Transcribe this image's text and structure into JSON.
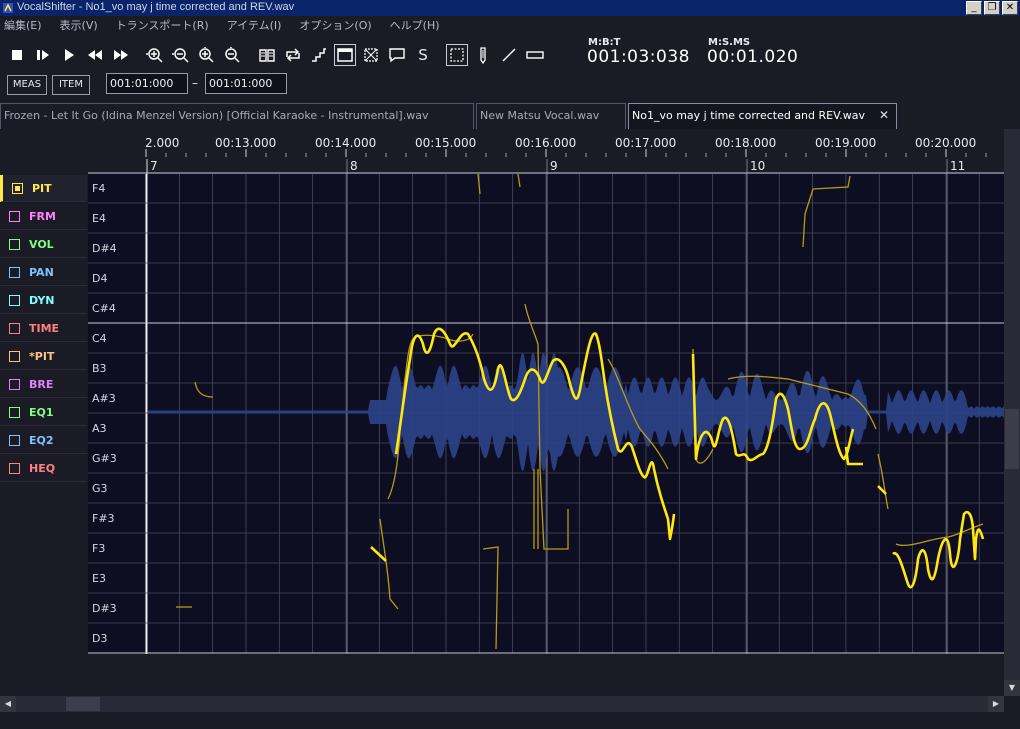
{
  "window": {
    "title": "VocalShifter - No1_vo may j time corrected and REV.wav",
    "buttons": [
      "_",
      "❐",
      "✕"
    ]
  },
  "menu": [
    "編集(E)",
    "表示(V)",
    "トランスポート(R)",
    "アイテム(I)",
    "オプション(O)",
    "ヘルプ(H)"
  ],
  "toolbar": {
    "icons": [
      "stop-icon",
      "play-from-start-icon",
      "play-icon",
      "rewind-icon",
      "fast-forward-icon",
      "zoom-in-horizontal-icon",
      "zoom-out-horizontal-icon",
      "zoom-in-vertical-icon",
      "zoom-out-vertical-icon",
      "book-icon",
      "loop-icon",
      "step-icon",
      "window-icon",
      "crossout-icon",
      "comment-icon",
      "solo-icon",
      "select-rect-icon",
      "pencil-icon",
      "line-icon",
      "eraser-icon"
    ],
    "solo_label": "S",
    "mbt_label": "M:B:T",
    "mbt_value": "001:03:038",
    "msms_label": "M:S.MS",
    "msms_value": "00:01.020",
    "meas_label": "MEAS",
    "item_label": "ITEM",
    "range_start": "001:01:000",
    "range_end": "001:01:000",
    "dash": "–"
  },
  "tabs": [
    {
      "label": "Frozen - Let It Go (Idina Menzel Version) [Official Karaoke - Instrumental].wav",
      "active": false
    },
    {
      "label": "New Matsu Vocal.wav",
      "active": false
    },
    {
      "label": "No1_vo may j time corrected and REV.wav",
      "active": true,
      "close": "✕"
    }
  ],
  "params": [
    {
      "label": "PIT",
      "color": "#ffe94a",
      "active": true
    },
    {
      "label": "FRM",
      "color": "#ff80ff",
      "active": false
    },
    {
      "label": "VOL",
      "color": "#80ff80",
      "active": false
    },
    {
      "label": "PAN",
      "color": "#80c0ff",
      "active": false
    },
    {
      "label": "DYN",
      "color": "#80ffff",
      "active": false
    },
    {
      "label": "TIME",
      "color": "#ff8080",
      "active": false
    },
    {
      "label": "*PIT",
      "color": "#ffc080",
      "active": false
    },
    {
      "label": "BRE",
      "color": "#e080ff",
      "active": false
    },
    {
      "label": "EQ1",
      "color": "#80ff80",
      "active": false
    },
    {
      "label": "EQ2",
      "color": "#80c0ff",
      "active": false
    },
    {
      "label": "HEQ",
      "color": "#ff8080",
      "active": false
    }
  ],
  "timeline": {
    "time_labels": [
      "2.000",
      "00:13.000",
      "00:14.000",
      "00:15.000",
      "00:16.000",
      "00:17.000",
      "00:18.000",
      "00:19.000",
      "00:20.000"
    ],
    "measure_labels": [
      "7",
      "8",
      "9",
      "10",
      "11"
    ]
  },
  "notes": [
    "F4",
    "E4",
    "D#4",
    "D4",
    "C#4",
    "C4",
    "B3",
    "A#3",
    "A3",
    "G#3",
    "G3",
    "F#3",
    "F3",
    "E3",
    "D#3",
    "D3"
  ],
  "colors": {
    "background": "#0e0e22",
    "grid": "#4a4a5c",
    "waveform": "#2b4488",
    "pitch_curve": "#ffe812",
    "original_pitch": "#b89a18"
  }
}
